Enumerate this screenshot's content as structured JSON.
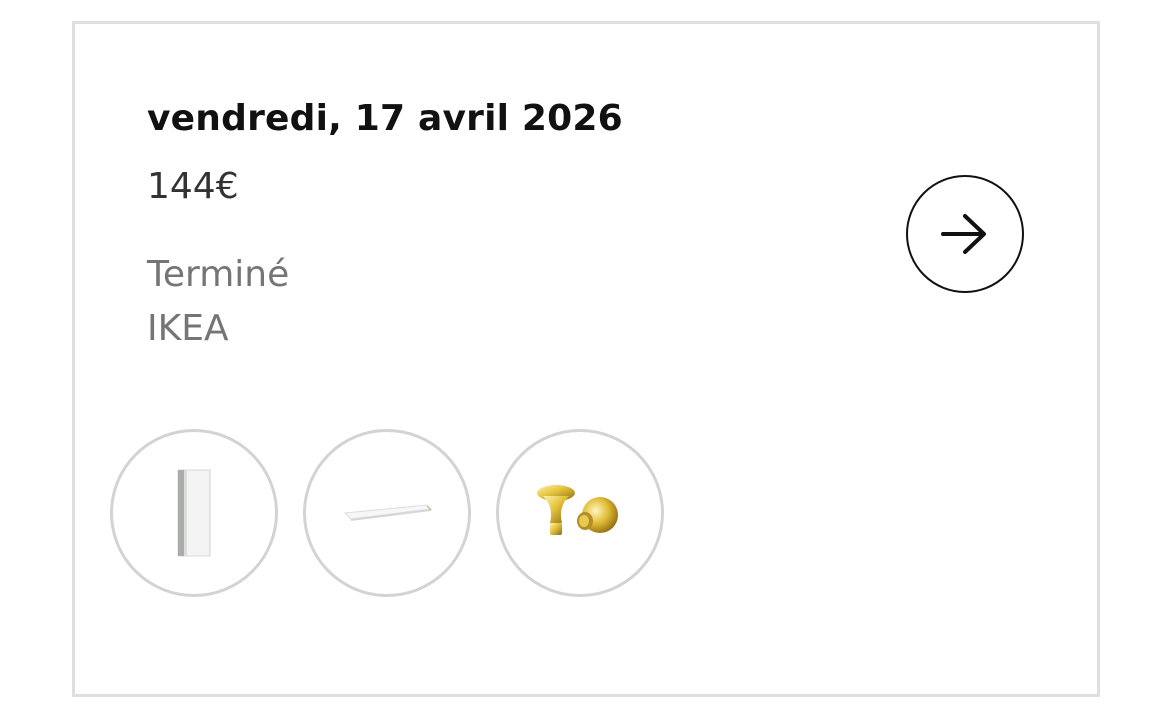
{
  "order": {
    "date": "vendredi, 17 avril 2026",
    "price": "144€",
    "status": "Terminé",
    "store": "IKEA",
    "open_icon": "arrow-right-icon"
  },
  "products": [
    {
      "icon": "wardrobe-product-image"
    },
    {
      "icon": "shelf-product-image"
    },
    {
      "icon": "gold-knobs-product-image"
    }
  ]
}
